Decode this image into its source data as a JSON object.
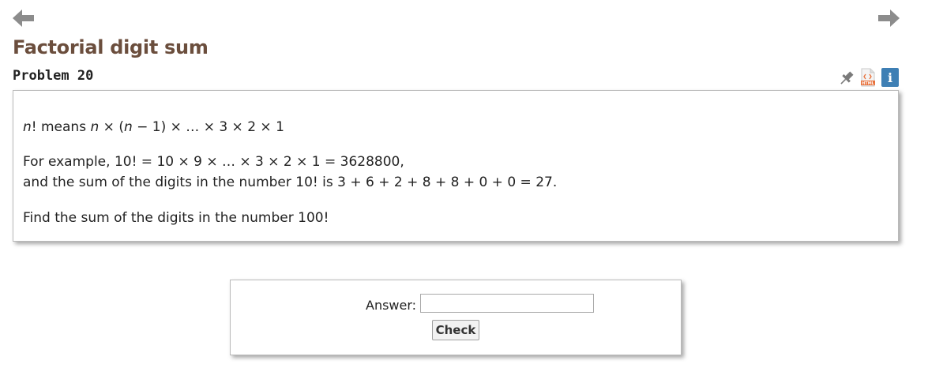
{
  "nav": {
    "prev_icon": "arrow-left-icon",
    "next_icon": "arrow-right-icon"
  },
  "header": {
    "title": "Factorial digit sum",
    "problem_label": "Problem 20"
  },
  "tools": {
    "pin_icon": "pin-icon",
    "html_icon": "html-icon",
    "info_icon": "info-icon",
    "info_glyph": "i",
    "html_badge": "HTML"
  },
  "problem": {
    "line1": {
      "n": "n",
      "rest1": "! means ",
      "n2": "n",
      "mid": " × (",
      "n3": "n",
      "rest2": " − 1) × … × 3 × 2 × 1"
    },
    "line2": "For example, 10! = 10 × 9 × … × 3 × 2 × 1 = 3628800,",
    "line3": "and the sum of the digits in the number 10! is 3 + 6 + 2 + 8 + 8 + 0 + 0 = 27.",
    "line4": "Find the sum of the digits in the number 100!"
  },
  "answer": {
    "label": "Answer:",
    "value": "",
    "button_label": "Check"
  },
  "colors": {
    "title": "#6b4e3d",
    "arrows": "#8c8c8c",
    "info_bg": "#3e7fb4",
    "html_badge": "#e8703a"
  }
}
